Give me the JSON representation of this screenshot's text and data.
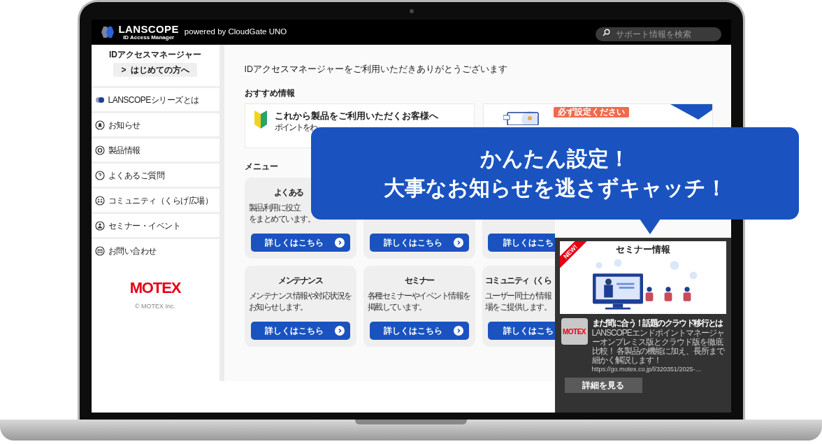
{
  "header": {
    "logo": "LANSCOPE",
    "logo_sub": "ID Access Manager",
    "powered": "powered by CloudGate UNO",
    "search": {
      "placeholder": "サポート情報を検索"
    }
  },
  "sidebar": {
    "title": "IDアクセスマネージャー",
    "first_button": "はじめての方へ",
    "chevron": ">",
    "items": [
      {
        "label": "LANSCOPEシリーズとは"
      },
      {
        "label": "お知らせ"
      },
      {
        "label": "製品情報"
      },
      {
        "label": "よくあるご質問"
      },
      {
        "label": "コミュニティ（くらげ広場）"
      },
      {
        "label": "セミナー・イベント"
      },
      {
        "label": "お問い合わせ"
      }
    ],
    "brand": "MOTEX",
    "copyright": "© MOTEX Inc."
  },
  "main": {
    "welcome": "IDアクセスマネージャーをご利用いただきありがとうございます",
    "recommend_heading": "おすすめ情報",
    "recommend_cards": [
      {
        "title": "これから製品をご利用いただくお客様へ",
        "subtitle": "ポイントをわ"
      },
      {
        "badge": "必ず設定ください"
      }
    ],
    "menu_heading": "メニュー",
    "menu_cards": [
      {
        "title": "よくある",
        "lines": [
          "製品利用に役立",
          "をまとめています。"
        ],
        "button": "詳しくはこちら"
      },
      {
        "button": "詳しくはこちら"
      },
      {
        "button": "詳しくはこち"
      },
      {
        "title": "メンテナンス",
        "lines": [
          "メンテナンス情報や対応状況を",
          "お知らせします。"
        ],
        "button": "詳しくはこちら"
      },
      {
        "title": "セミナー",
        "lines": [
          "各種セミナーやイベント情報を",
          "掲載しています。"
        ],
        "button": "詳しくはこちら"
      },
      {
        "title": "コミュニティ（くら",
        "lines": [
          "ユーザー同士が情報",
          "場をご提供します。"
        ],
        "button": "詳しくはこち"
      }
    ]
  },
  "popup": {
    "ribbon": "NEW!",
    "image_title": "セミナー情報",
    "logo": "MOTEX",
    "title": "まだ間に合う！話題のクラウド移行とは",
    "description": "LANSCOPEエンドポイントマネージャーオンプレミス版とクラウド版を徹底比較！ 各製品の機能に加え、長所まで細かく解説します！",
    "url": "https://go.motex.co.jp/l/320351/2025-…",
    "button": "詳細を見る"
  },
  "callout": {
    "lines": [
      "かんたん設定！",
      "大事なお知らせを逃さずキャッチ！"
    ]
  }
}
